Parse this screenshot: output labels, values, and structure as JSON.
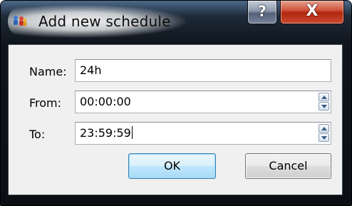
{
  "window": {
    "title": "Add new schedule",
    "help_glyph": "?",
    "close_glyph": "X"
  },
  "form": {
    "name_label": "Name:",
    "name_value": "24h",
    "from_label": "From:",
    "from_value": "00:00:00",
    "to_label": "To:",
    "to_value": "23:59:59"
  },
  "buttons": {
    "ok_label": "OK",
    "cancel_label": "Cancel"
  },
  "icons": {
    "app": "calendar-people-icon",
    "spin_up": "spin-up-arrow-icon",
    "spin_down": "spin-down-arrow-icon"
  },
  "colors": {
    "close_button": "#c84b2f",
    "default_button_border": "#3c7fb1"
  }
}
